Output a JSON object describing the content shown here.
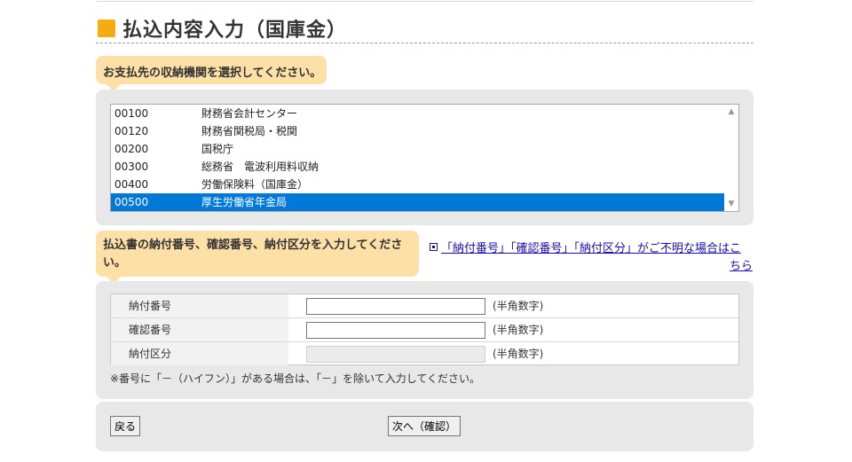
{
  "page": {
    "title": "払込内容入力（国庫金）"
  },
  "section1": {
    "instruction": "お支払先の収納機関を選択してください。",
    "options": [
      {
        "code": "00100",
        "name": "財務省会計センター"
      },
      {
        "code": "00120",
        "name": "財務省関税局・税関"
      },
      {
        "code": "00200",
        "name": "国税庁"
      },
      {
        "code": "00300",
        "name": "総務省　電波利用料収納"
      },
      {
        "code": "00400",
        "name": "労働保険料（国庫金）"
      },
      {
        "code": "00500",
        "name": "厚生労働省年金局"
      }
    ],
    "selected_code": "00500"
  },
  "section2": {
    "instruction": "払込書の納付番号、確認番号、納付区分を入力してください。",
    "help_link_line1": "「納付番号」「確認番号」「納付区分」がご不明な場合はこ",
    "help_link_line2": "ちら",
    "fields": [
      {
        "label": "納付番号",
        "value": "",
        "hint": "(半角数字)",
        "disabled": false
      },
      {
        "label": "確認番号",
        "value": "",
        "hint": "(半角数字)",
        "disabled": false
      },
      {
        "label": "納付区分",
        "value": "",
        "hint": "(半角数字)",
        "disabled": true
      }
    ],
    "note": "※番号に「－（ハイフン）」がある場合は、「－」を除いて入力してください。"
  },
  "buttons": {
    "back_label": "戻る",
    "next_label": "次へ（確認）"
  },
  "colors": {
    "accent": "#f6ab14",
    "bubble": "#fde0a6",
    "selection": "#0078d7",
    "panel": "#e8e8e8",
    "link": "#1a0dab"
  },
  "icons": {
    "title_marker": "square-marker-icon",
    "link_icon": "external-link-icon"
  }
}
